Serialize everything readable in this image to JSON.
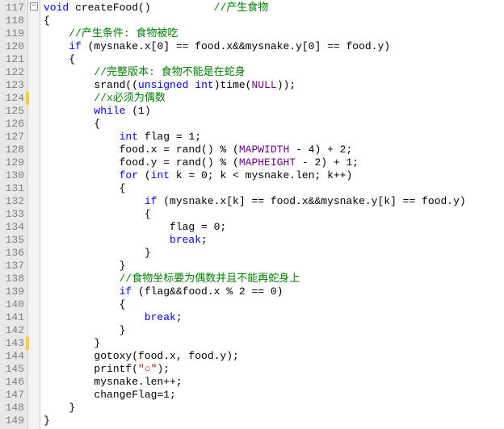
{
  "lines": [
    {
      "n": 117,
      "fold": "minus",
      "code": [
        [
          "kw",
          "void"
        ],
        [
          "plain",
          " createFood()          "
        ],
        [
          "cmt",
          "//产生食物"
        ]
      ]
    },
    {
      "n": 118,
      "code": [
        [
          "plain",
          "{"
        ]
      ]
    },
    {
      "n": 119,
      "code": [
        [
          "plain",
          "    "
        ],
        [
          "cmt",
          "//产生条件: 食物被吃"
        ]
      ]
    },
    {
      "n": 120,
      "code": [
        [
          "plain",
          "    "
        ],
        [
          "kw",
          "if"
        ],
        [
          "plain",
          " (mysnake.x[0] == food.x&&mysnake.y[0] == food.y)"
        ]
      ]
    },
    {
      "n": 121,
      "code": [
        [
          "plain",
          "    {"
        ]
      ]
    },
    {
      "n": 122,
      "code": [
        [
          "plain",
          "        "
        ],
        [
          "cmt",
          "//完整版本: 食物不能是在蛇身"
        ]
      ]
    },
    {
      "n": 123,
      "code": [
        [
          "plain",
          "        srand(("
        ],
        [
          "kw",
          "unsigned"
        ],
        [
          "plain",
          " "
        ],
        [
          "kw",
          "int"
        ],
        [
          "plain",
          ")time("
        ],
        [
          "macro",
          "NULL"
        ],
        [
          "plain",
          "));"
        ]
      ]
    },
    {
      "n": 124,
      "mark": true,
      "code": [
        [
          "plain",
          "        "
        ],
        [
          "cmt",
          "//x必须为偶数"
        ]
      ]
    },
    {
      "n": 125,
      "code": [
        [
          "plain",
          "        "
        ],
        [
          "kw",
          "while"
        ],
        [
          "plain",
          " (1)"
        ]
      ]
    },
    {
      "n": 126,
      "code": [
        [
          "plain",
          "        {"
        ]
      ]
    },
    {
      "n": 127,
      "code": [
        [
          "plain",
          "            "
        ],
        [
          "kw",
          "int"
        ],
        [
          "plain",
          " flag = 1;"
        ]
      ]
    },
    {
      "n": 128,
      "code": [
        [
          "plain",
          "            food.x = rand() % ("
        ],
        [
          "macro",
          "MAPWIDTH"
        ],
        [
          "plain",
          " - 4) + 2;"
        ]
      ]
    },
    {
      "n": 129,
      "code": [
        [
          "plain",
          "            food.y = rand() % ("
        ],
        [
          "macro",
          "MAPHEIGHT"
        ],
        [
          "plain",
          " - 2) + 1;"
        ]
      ]
    },
    {
      "n": 130,
      "code": [
        [
          "plain",
          "            "
        ],
        [
          "kw",
          "for"
        ],
        [
          "plain",
          " ("
        ],
        [
          "kw",
          "int"
        ],
        [
          "plain",
          " k = 0; k < mysnake.len; k++)"
        ]
      ]
    },
    {
      "n": 131,
      "code": [
        [
          "plain",
          "            {"
        ]
      ]
    },
    {
      "n": 132,
      "code": [
        [
          "plain",
          "                "
        ],
        [
          "kw",
          "if"
        ],
        [
          "plain",
          " (mysnake.x[k] == food.x&&mysnake.y[k] == food.y)"
        ]
      ]
    },
    {
      "n": 133,
      "code": [
        [
          "plain",
          "                {"
        ]
      ]
    },
    {
      "n": 134,
      "code": [
        [
          "plain",
          "                    flag = 0;"
        ]
      ]
    },
    {
      "n": 135,
      "code": [
        [
          "plain",
          "                    "
        ],
        [
          "kw",
          "break"
        ],
        [
          "plain",
          ";"
        ]
      ]
    },
    {
      "n": 136,
      "code": [
        [
          "plain",
          "                }"
        ]
      ]
    },
    {
      "n": 137,
      "code": [
        [
          "plain",
          "            }"
        ]
      ]
    },
    {
      "n": 138,
      "code": [
        [
          "plain",
          "            "
        ],
        [
          "cmt",
          "//食物坐标要为偶数并且不能再蛇身上"
        ]
      ]
    },
    {
      "n": 139,
      "code": [
        [
          "plain",
          "            "
        ],
        [
          "kw",
          "if"
        ],
        [
          "plain",
          " (flag&&food.x % 2 == 0)"
        ]
      ]
    },
    {
      "n": 140,
      "code": [
        [
          "plain",
          "            {"
        ]
      ]
    },
    {
      "n": 141,
      "code": [
        [
          "plain",
          "                "
        ],
        [
          "kw",
          "break"
        ],
        [
          "plain",
          ";"
        ]
      ]
    },
    {
      "n": 142,
      "code": [
        [
          "plain",
          "            }"
        ]
      ]
    },
    {
      "n": 143,
      "mark": true,
      "code": [
        [
          "plain",
          "        }"
        ]
      ]
    },
    {
      "n": 144,
      "code": [
        [
          "plain",
          "        gotoxy(food.x, food.y);"
        ]
      ]
    },
    {
      "n": 145,
      "code": [
        [
          "plain",
          "        printf("
        ],
        [
          "str",
          "\"○\""
        ],
        [
          "plain",
          ");"
        ]
      ]
    },
    {
      "n": 146,
      "code": [
        [
          "plain",
          "        mysnake.len++;"
        ]
      ]
    },
    {
      "n": 147,
      "code": [
        [
          "plain",
          "        changeFlag=1;"
        ]
      ]
    },
    {
      "n": 148,
      "code": [
        [
          "plain",
          "    }"
        ]
      ]
    },
    {
      "n": 149,
      "code": [
        [
          "plain",
          "}"
        ]
      ]
    }
  ]
}
